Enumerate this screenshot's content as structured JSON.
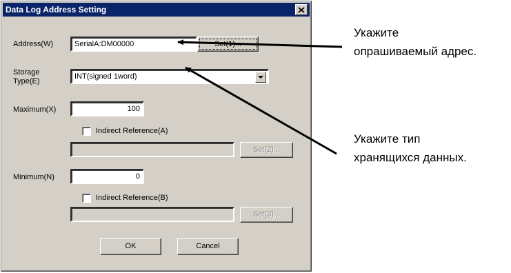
{
  "window": {
    "title": "Data Log Address Setting"
  },
  "address": {
    "label": "Address(W)",
    "value": "SerialA:DM00000",
    "set_button": "Set(1)..."
  },
  "storage_type": {
    "label_line1": "Storage",
    "label_line2": "Type(E)",
    "value": "INT(signed 1word)"
  },
  "maximum": {
    "label": "Maximum(X)",
    "value": "100",
    "indirect_label": "Indirect Reference(A)",
    "set_button": "Set(2)..."
  },
  "minimum": {
    "label": "Minimum(N)",
    "value": "0",
    "indirect_label": "Indirect Reference(B)",
    "set_button": "Set(3)..."
  },
  "buttons": {
    "ok": "OK",
    "cancel": "Cancel"
  },
  "annotations": {
    "address_note": [
      "Укажите",
      "опрашиваемый адрес."
    ],
    "type_note": [
      "Укажите тип",
      "хранящихся данных."
    ]
  }
}
